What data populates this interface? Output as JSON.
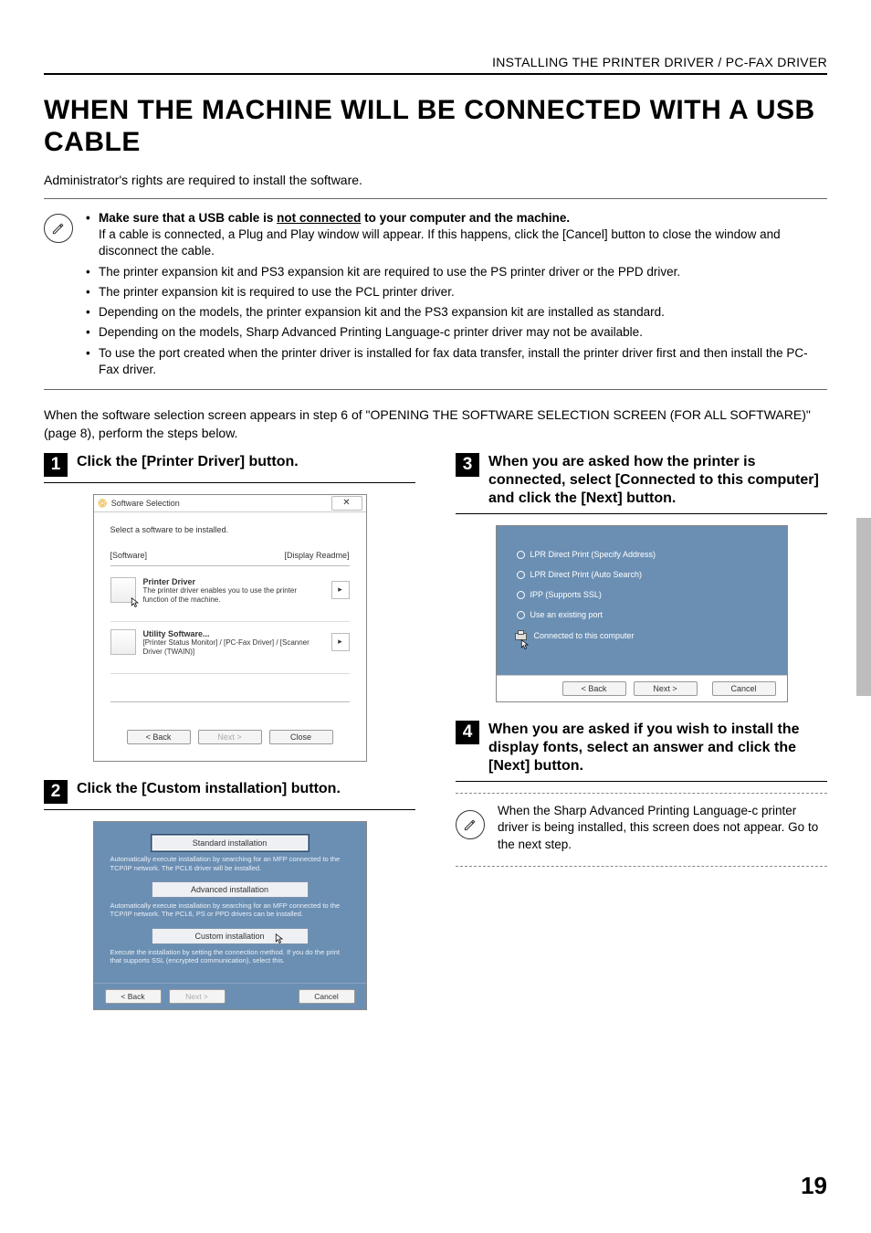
{
  "running_header": "INSTALLING THE PRINTER DRIVER / PC-FAX DRIVER",
  "title": "WHEN THE MACHINE WILL BE CONNECTED WITH A USB CABLE",
  "intro": "Administrator's rights are required to install the software.",
  "note_box": {
    "first_bold_pre": "Make sure that a USB cable is ",
    "first_bold_underlined": "not connected",
    "first_bold_post": " to your computer and the machine.",
    "first_sub": "If a cable is connected, a Plug and Play window will appear. If this happens, click the [Cancel] button to close the window and disconnect the cable.",
    "bullets": [
      "The printer expansion kit and PS3 expansion kit are required to use the PS printer driver or the PPD driver.",
      "The printer expansion kit is required to use the PCL printer driver.",
      "Depending on the models, the printer expansion kit and the PS3 expansion kit are installed as standard.",
      "Depending on the models, Sharp Advanced Printing Language-c printer driver may not be available.",
      "To use the port created when the printer driver is installed for fax data transfer, install the printer driver first and then install the PC-Fax driver."
    ]
  },
  "between": "When the software selection screen appears in step 6 of \"OPENING THE SOFTWARE SELECTION SCREEN (FOR ALL SOFTWARE)\" (page 8), perform the steps below.",
  "steps": {
    "s1": {
      "num": "1",
      "title": "Click the [Printer Driver] button."
    },
    "s2": {
      "num": "2",
      "title": "Click the [Custom installation] button."
    },
    "s3": {
      "num": "3",
      "title": "When you are asked how the printer is connected, select [Connected to this computer] and click the [Next] button."
    },
    "s4": {
      "num": "4",
      "title": "When you are asked if you wish to install the display fonts, select an answer and click the [Next] button."
    }
  },
  "dlg1": {
    "title": "Software Selection",
    "subtitle": "Select a software to be installed.",
    "tab_left": "[Software]",
    "tab_right": "[Display Readme]",
    "item1": {
      "name": "Printer Driver",
      "desc": "The printer driver enables you to use the printer function of the machine."
    },
    "item2": {
      "name": "Utility Software...",
      "desc": "[Printer Status Monitor] / [PC-Fax Driver] / [Scanner Driver (TWAIN)]"
    },
    "btn_back": "< Back",
    "btn_next": "Next >",
    "btn_close": "Close"
  },
  "dlg2": {
    "opt1": {
      "btn": "Standard installation",
      "desc": "Automatically execute installation by searching for an MFP connected to the TCP/IP network. The PCL6 driver will be installed."
    },
    "opt2": {
      "btn": "Advanced installation",
      "desc": "Automatically execute installation by searching for an MFP connected to the TCP/IP network. The PCL6, PS or PPD drivers can be installed."
    },
    "opt3": {
      "btn": "Custom installation",
      "desc": "Execute the installation by setting the connection method. If you do the print that supports SSL (encrypted communication), select this."
    },
    "btn_back": "< Back",
    "btn_next": "Next >",
    "btn_cancel": "Cancel"
  },
  "dlg3": {
    "r1": "LPR Direct Print (Specify Address)",
    "r2": "LPR Direct Print (Auto Search)",
    "r3": "IPP (Supports SSL)",
    "r4": "Use an existing port",
    "r5": "Connected to this computer",
    "btn_back": "< Back",
    "btn_next": "Next >",
    "btn_cancel": "Cancel"
  },
  "inline_note": "When the Sharp Advanced Printing Language-c printer driver is being installed, this screen does not appear. Go to the next step.",
  "page_number": "19"
}
